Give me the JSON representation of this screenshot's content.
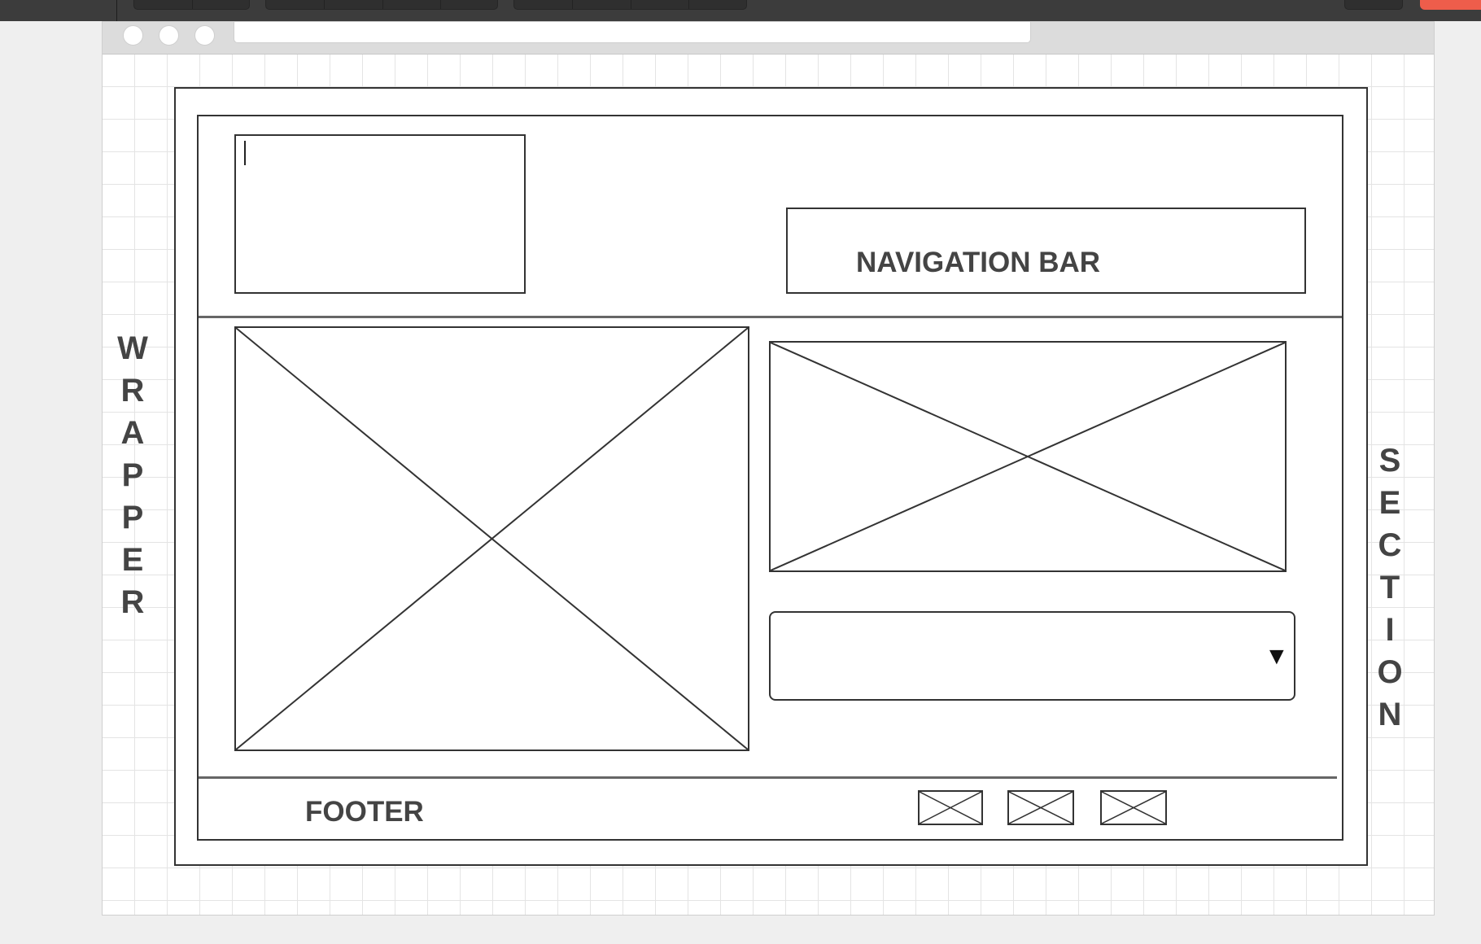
{
  "wireframe": {
    "side_label_left": [
      "W",
      "R",
      "A",
      "P",
      "P",
      "E",
      "R"
    ],
    "side_label_right": [
      "S",
      "E",
      "C",
      "T",
      "I",
      "O",
      "N"
    ],
    "nav_label": "NAVIGATION BAR",
    "footer_label": "FOOTER",
    "dropdown_arrow": "▼"
  },
  "colors": {
    "toolbar": "#3c3c3c",
    "accent_red": "#ee5d4b",
    "stroke": "#333333",
    "label": "#444444"
  }
}
